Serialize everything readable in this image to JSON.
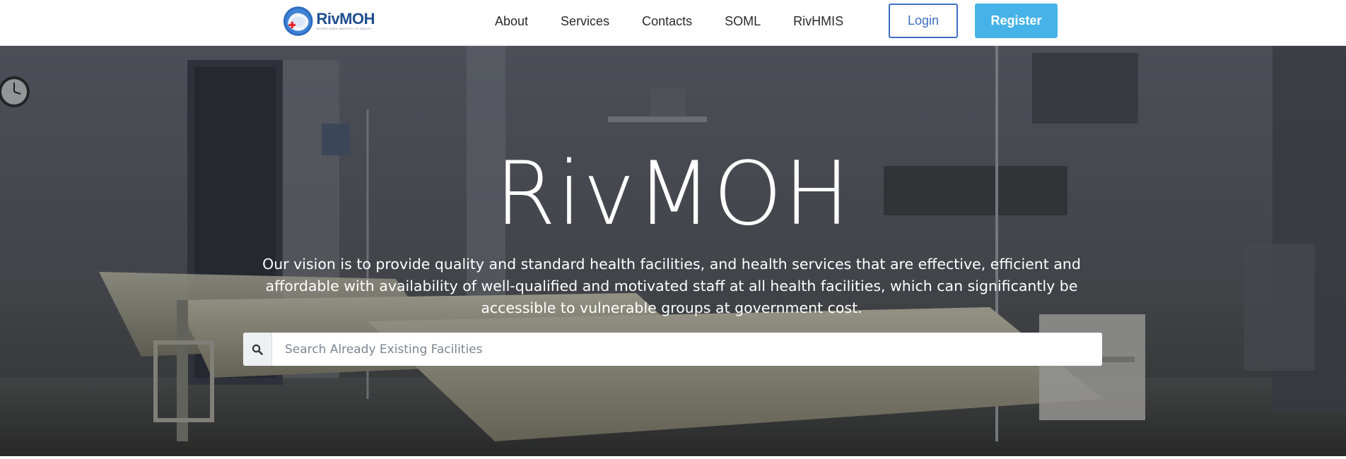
{
  "header": {
    "brand": {
      "name": "RivMOH",
      "tagline": "RIVERS STATE MINISTRY OF HEALTH",
      "logo_icon": "rivers-state-map-red-cross-icon"
    },
    "nav": [
      {
        "label": "About"
      },
      {
        "label": "Services"
      },
      {
        "label": "Contacts"
      },
      {
        "label": "SOML"
      },
      {
        "label": "RivHMIS"
      }
    ],
    "login_label": "Login",
    "register_label": "Register"
  },
  "hero": {
    "title": "RivMOH",
    "description": "Our vision is to provide quality and standard health facilities, and health services that are effective, efficient and affordable with availability of well-qualified and motivated staff at all health facilities, which can significantly be accessible to vulnerable groups at government cost.",
    "background": "hospital-ward-photo",
    "search": {
      "icon": "search-icon",
      "placeholder": "Search Already Existing Facilities",
      "value": ""
    }
  },
  "colors": {
    "brand_blue": "#1f4f8f",
    "login_border": "#3d6fc2",
    "register_bg": "#45b3e7",
    "logo_red": "#e8232a"
  }
}
